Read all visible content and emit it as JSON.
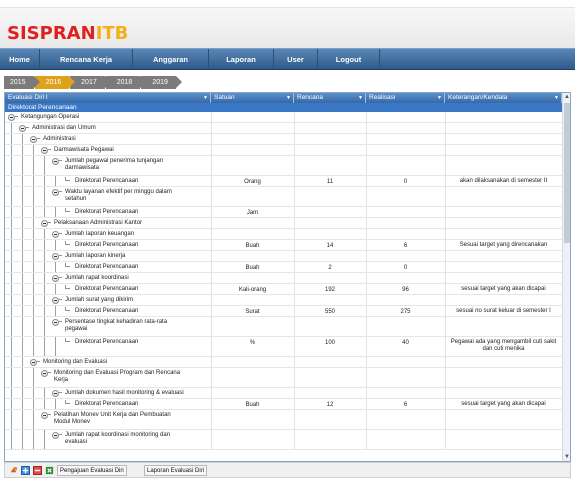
{
  "app": {
    "logo_part1": "SISPRAN",
    "logo_part2": "ITB"
  },
  "nav": [
    "Home",
    "Rencana Kerja",
    "Anggaran",
    "Laporan",
    "User",
    "Logout"
  ],
  "years": {
    "items": [
      "2015",
      "2016",
      "2017",
      "2018",
      "2019"
    ],
    "active": "2016"
  },
  "grid": {
    "headers": [
      "Evaluasi Diri I",
      "Satuan",
      "Rencana",
      "Realisasi",
      "Keterangan/Kendala"
    ],
    "group": "Direktorat Perencanaan",
    "rows": [
      {
        "level": 0,
        "toggle": true,
        "leaf": false,
        "lines": [
          "Ketangungan Operasi"
        ]
      },
      {
        "level": 1,
        "toggle": true,
        "leaf": false,
        "lines": [
          "Administrasi dan Umum"
        ]
      },
      {
        "level": 2,
        "toggle": true,
        "leaf": false,
        "lines": [
          "Administrasi"
        ]
      },
      {
        "level": 3,
        "toggle": true,
        "leaf": false,
        "lines": [
          "Darmawisata Pegawai"
        ]
      },
      {
        "level": 4,
        "toggle": true,
        "leaf": false,
        "lines": [
          "Jumlah pegawai penerima tunjangan",
          "darmawisata"
        ]
      },
      {
        "level": 5,
        "toggle": false,
        "leaf": true,
        "lines": [
          "Direktorat Perencanaan"
        ],
        "satuan": "Orang",
        "rencana": "11",
        "realisasi": "0",
        "keterangan": [
          "akan dilaksanakan di semester II"
        ]
      },
      {
        "level": 4,
        "toggle": true,
        "leaf": false,
        "lines": [
          "Waktu layanan efektif per minggu dalam",
          "setahun"
        ]
      },
      {
        "level": 5,
        "toggle": false,
        "leaf": true,
        "lines": [
          "Direktorat Perencanaan"
        ],
        "satuan": "Jam",
        "rencana": "",
        "realisasi": "",
        "keterangan": []
      },
      {
        "level": 3,
        "toggle": true,
        "leaf": false,
        "lines": [
          "Pelaksanaan Administrasi Kantor"
        ]
      },
      {
        "level": 4,
        "toggle": true,
        "leaf": false,
        "lines": [
          "Jumlah laporan keuangan"
        ]
      },
      {
        "level": 5,
        "toggle": false,
        "leaf": true,
        "lines": [
          "Direktorat Perencanaan"
        ],
        "satuan": "Buah",
        "rencana": "14",
        "realisasi": "6",
        "keterangan": [
          "Sesuai target yang direncanakan"
        ]
      },
      {
        "level": 4,
        "toggle": true,
        "leaf": false,
        "lines": [
          "Jumlah laporan kinerja"
        ]
      },
      {
        "level": 5,
        "toggle": false,
        "leaf": true,
        "lines": [
          "Direktorat Perencanaan"
        ],
        "satuan": "Buah",
        "rencana": "2",
        "realisasi": "0",
        "keterangan": []
      },
      {
        "level": 4,
        "toggle": true,
        "leaf": false,
        "lines": [
          "Jumlah rapat koordinasi"
        ]
      },
      {
        "level": 5,
        "toggle": false,
        "leaf": true,
        "lines": [
          "Direktorat Perencanaan"
        ],
        "satuan": "Kali-orang",
        "rencana": "192",
        "realisasi": "96",
        "keterangan": [
          "sesuai target yang akan dicapai"
        ]
      },
      {
        "level": 4,
        "toggle": true,
        "leaf": false,
        "lines": [
          "Jumlah surat yang dikirim"
        ]
      },
      {
        "level": 5,
        "toggle": false,
        "leaf": true,
        "lines": [
          "Direktorat Perencanaan"
        ],
        "satuan": "Surat",
        "rencana": "550",
        "realisasi": "275",
        "keterangan": [
          "sesuai no surat keluar di semester I"
        ]
      },
      {
        "level": 4,
        "toggle": true,
        "leaf": false,
        "lines": [
          "Persentase tingkat kehadiran rata-rata",
          "pegawai"
        ]
      },
      {
        "level": 5,
        "toggle": false,
        "leaf": true,
        "lines": [
          "Direktorat Perencanaan"
        ],
        "satuan": "%",
        "rencana": "100",
        "realisasi": "40",
        "keterangan": [
          "Pegawai ada yang mengambil cuti sakit",
          "dan cuti menika"
        ]
      },
      {
        "level": 2,
        "toggle": true,
        "leaf": false,
        "lines": [
          "Monitoring dan Evaluasi"
        ]
      },
      {
        "level": 3,
        "toggle": true,
        "leaf": false,
        "lines": [
          "Monitoring dan Evaluasi Program dan Rencana",
          "Kerja"
        ]
      },
      {
        "level": 4,
        "toggle": true,
        "leaf": false,
        "lines": [
          "Jumlah dokumen hasil monitoring & evaluasi"
        ]
      },
      {
        "level": 5,
        "toggle": false,
        "leaf": true,
        "lines": [
          "Direktorat Perencanaan"
        ],
        "satuan": "Buah",
        "rencana": "12",
        "realisasi": "6",
        "keterangan": [
          "sesuai target yang akan dicapai"
        ]
      },
      {
        "level": 3,
        "toggle": true,
        "leaf": false,
        "lines": [
          "Pelatihan Monev Unit Kerja dan Pembuatan",
          "Modul Monev"
        ]
      },
      {
        "level": 4,
        "toggle": true,
        "leaf": false,
        "lines": [
          "Jumlah rapat koordinasi monitoring dan",
          "evaluasi"
        ]
      }
    ]
  },
  "toolbar": {
    "icons": [
      "refresh-icon",
      "add-icon",
      "delete-icon",
      "export-excel-icon"
    ],
    "buttons": [
      "Pengajuan Evaluasi Diri",
      "Laporan Evaluasi Diri"
    ]
  },
  "colors": {
    "header_blue": "#3468a8",
    "nav_blue": "#2f5b8c",
    "year_active": "#e0a11a",
    "year_inactive": "#7b7b7b",
    "logo_red": "#e0201d",
    "logo_yellow": "#f4b018"
  }
}
